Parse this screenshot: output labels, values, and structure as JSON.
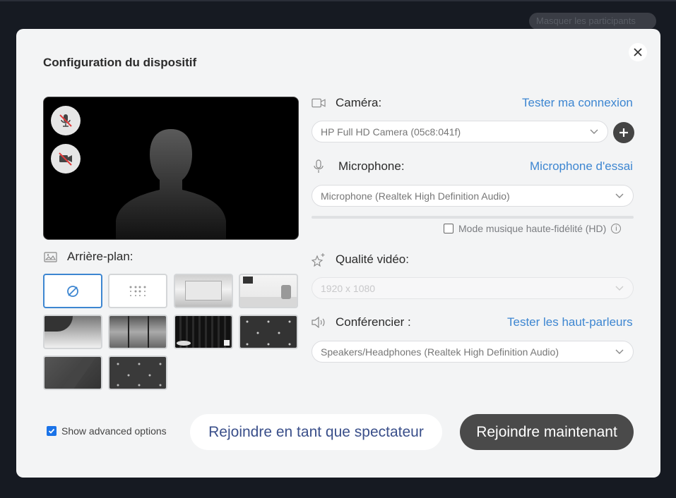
{
  "background": {
    "pill_text": "Masquer les participants"
  },
  "modal": {
    "title": "Configuration du dispositif",
    "close_label": "×"
  },
  "preview": {
    "mic_state": "muted",
    "camera_state": "off"
  },
  "camera": {
    "label": "Caméra:",
    "test_link": "Tester ma connexion",
    "selected": "HP Full HD Camera (05c8:041f)"
  },
  "microphone": {
    "label": "Microphone:",
    "test_link": "Microphone d'essai",
    "selected": "Microphone (Realtek High Definition Audio)",
    "level": 0,
    "hifi_label": "Mode musique haute-fidélité (HD)",
    "hifi_checked": false
  },
  "video_quality": {
    "label": "Qualité vidéo:",
    "selected": "1920 x 1080",
    "disabled": true
  },
  "speaker": {
    "label": "Conférencier :",
    "test_link": "Tester les haut-parleurs",
    "selected": "Speakers/Headphones (Realtek High Definition Audio)"
  },
  "background_section": {
    "label": "Arrière-plan:",
    "tiles": [
      "none",
      "blur",
      "empty-room",
      "office",
      "beach",
      "window-view",
      "dark-stage",
      "pattern-dark",
      "gradient-dark",
      "pattern-dark-2"
    ],
    "selected": "none"
  },
  "footer": {
    "advanced_label": "Show advanced options",
    "advanced_checked": true,
    "spectator_button": "Rejoindre en tant que spectateur",
    "join_button": "Rejoindre maintenant"
  },
  "colors": {
    "accent": "#3d86d1",
    "join_button_bg": "#4a4a4a",
    "modal_bg": "#f3f4f5",
    "page_bg": "#161a22"
  }
}
